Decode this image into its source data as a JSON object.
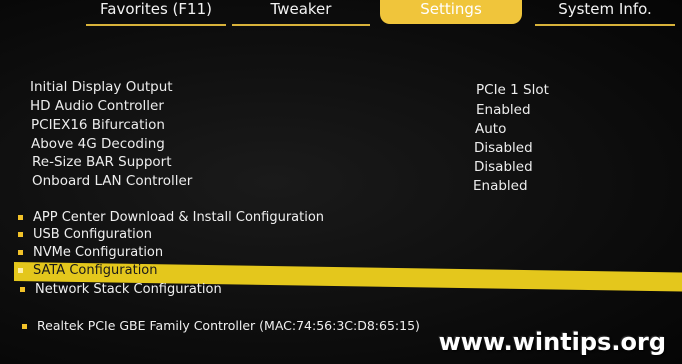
{
  "tabs": [
    {
      "label": "Favorites (F11)",
      "active": false
    },
    {
      "label": "Tweaker",
      "active": false
    },
    {
      "label": "Settings",
      "active": true
    },
    {
      "label": "System Info.",
      "active": false
    }
  ],
  "settings": [
    {
      "label": "Initial Display Output",
      "value": "PCIe 1 Slot"
    },
    {
      "label": "HD Audio Controller",
      "value": "Enabled"
    },
    {
      "label": "PCIEX16 Bifurcation",
      "value": "Auto"
    },
    {
      "label": "Above 4G Decoding",
      "value": "Disabled"
    },
    {
      "label": "Re-Size BAR Support",
      "value": "Disabled"
    },
    {
      "label": "Onboard LAN Controller",
      "value": "Enabled"
    }
  ],
  "submenus": [
    {
      "label": "APP Center Download & Install Configuration"
    },
    {
      "label": "USB Configuration"
    },
    {
      "label": "NVMe Configuration"
    },
    {
      "label": "SATA Configuration",
      "selected": true
    },
    {
      "label": "Network Stack Configuration"
    }
  ],
  "network": {
    "label": "Realtek PCIe GBE Family Controller (MAC:74:56:3C:D8:65:15)"
  },
  "watermark": "www.wintips.org",
  "colors": {
    "accent": "#f0c53b",
    "highlight": "#e4c71c",
    "background": "#0d0d0d"
  }
}
